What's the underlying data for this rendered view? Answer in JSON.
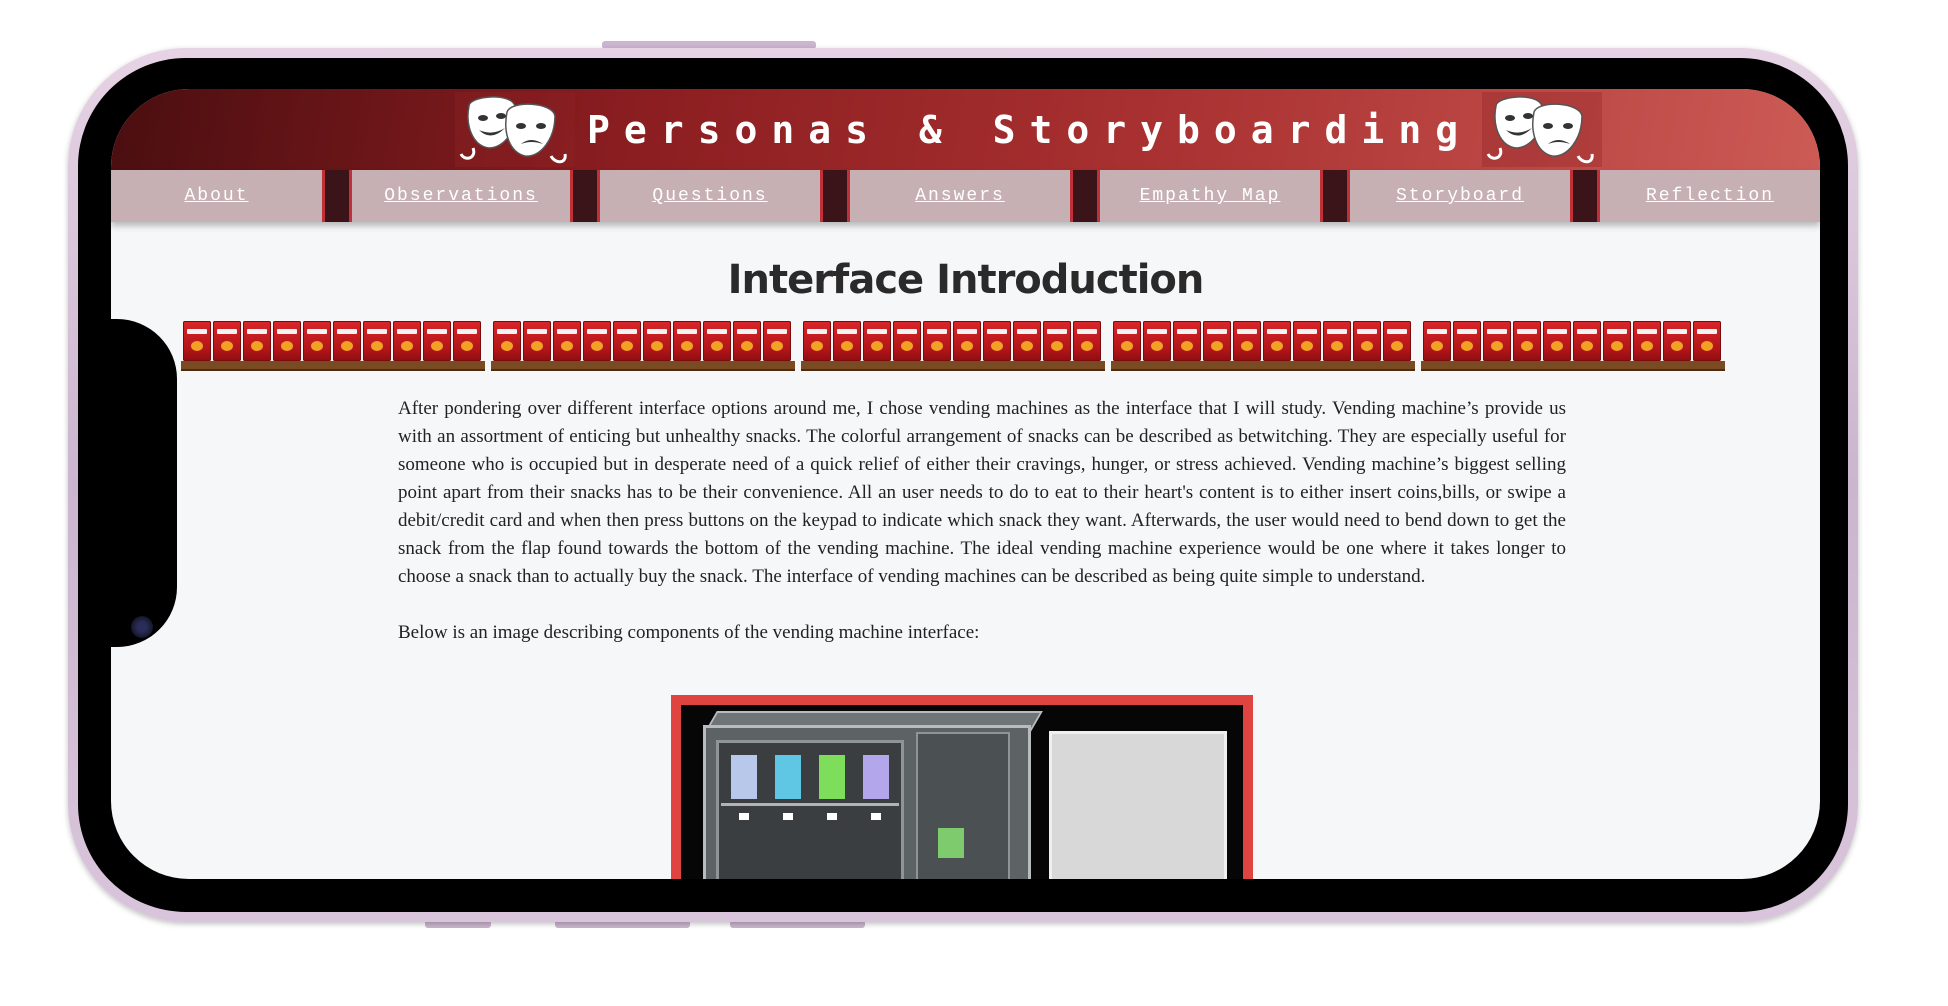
{
  "header": {
    "title": "Personas & Storyboarding",
    "left_icon": "theater-masks-icon",
    "right_icon": "theater-masks-icon"
  },
  "nav": {
    "items": [
      {
        "label": "About"
      },
      {
        "label": "Observations"
      },
      {
        "label": "Questions"
      },
      {
        "label": "Answers"
      },
      {
        "label": "Empathy Map"
      },
      {
        "label": "Storyboard"
      },
      {
        "label": "Reflection"
      }
    ]
  },
  "main": {
    "title": "Interface Introduction",
    "paragraph_1": "After pondering over different interface options around me, I chose vending machines as the interface that I will study. Vending machine’s provide us with an assortment of enticing but unhealthy snacks. The colorful arrangement of snacks can be described as betwitching. They are especially useful for someone who is occupied but in desperate need of a quick relief of either their cravings, hunger, or stress achieved. Vending machine’s biggest selling point apart from their snacks has to be their convenience. All an user needs to do to eat to their heart's content is to either insert coins,bills, or swipe a debit/credit card and when then press buttons on the keypad to indicate which snack they want. Afterwards, the user would need to bend down to get the snack from the flap found towards the bottom of the vending machine. The ideal vending machine experience would be one where it takes longer to choose a snack than to actually buy the snack. The interface of vending machines can be described as being quite simple to understand.",
    "paragraph_2": "Below is an image describing components of the vending machine interface:"
  },
  "colors": {
    "header_dark": "#4a0e10",
    "header_light": "#cc5a55",
    "nav_bg": "#c6b0b3",
    "nav_separator": "#3a1419",
    "page_bg": "#f6f7f9",
    "image_border": "#e04440"
  }
}
